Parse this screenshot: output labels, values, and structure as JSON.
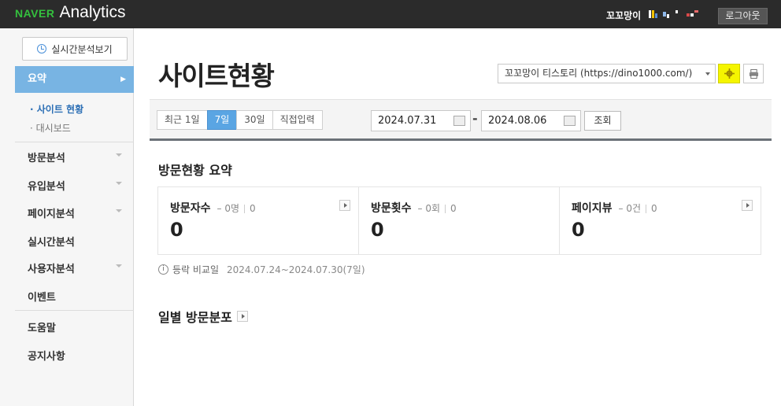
{
  "header": {
    "logo_brand": "NAVER",
    "logo_product": "Analytics",
    "user_name": "꼬꼬망이",
    "logout_label": "로그아웃"
  },
  "sidebar": {
    "realtime_button": "실시간분석보기",
    "active_menu": "요약",
    "sub_items": [
      "· 사이트 현황",
      "· 대시보드"
    ],
    "menu": [
      "방문분석",
      "유입분석",
      "페이지분석",
      "실시간분석",
      "사용자분석",
      "이벤트"
    ],
    "footer_menu": [
      "도움말",
      "공지사항"
    ]
  },
  "main": {
    "page_title": "사이트현황",
    "site_selector": "꼬꼬망이 티스토리 (https://dino1000.com/)",
    "range_tabs": [
      "최근 1일",
      "7일",
      "30일",
      "직접입력"
    ],
    "active_range": "7일",
    "start_date": "2024.07.31",
    "end_date": "2024.08.06",
    "date_separator": "-",
    "search_label": "조회",
    "summary_title": "방문현황 요약",
    "summary": [
      {
        "label": "방문자수",
        "delta": "– 0명",
        "prev": "0",
        "value": "0"
      },
      {
        "label": "방문횟수",
        "delta": "– 0회",
        "prev": "0",
        "value": "0"
      },
      {
        "label": "페이지뷰",
        "delta": "– 0건",
        "prev": "0",
        "value": "0"
      }
    ],
    "compare_label": "등락 비교일",
    "compare_value": "2024.07.24~2024.07.30(7일)",
    "daily_title": "일별 방문분포"
  },
  "colors": {
    "accent_blue": "#78b4e3",
    "tab_active": "#5aa5e3",
    "naver_green": "#34c03e",
    "gear_highlight": "#f5f500"
  }
}
